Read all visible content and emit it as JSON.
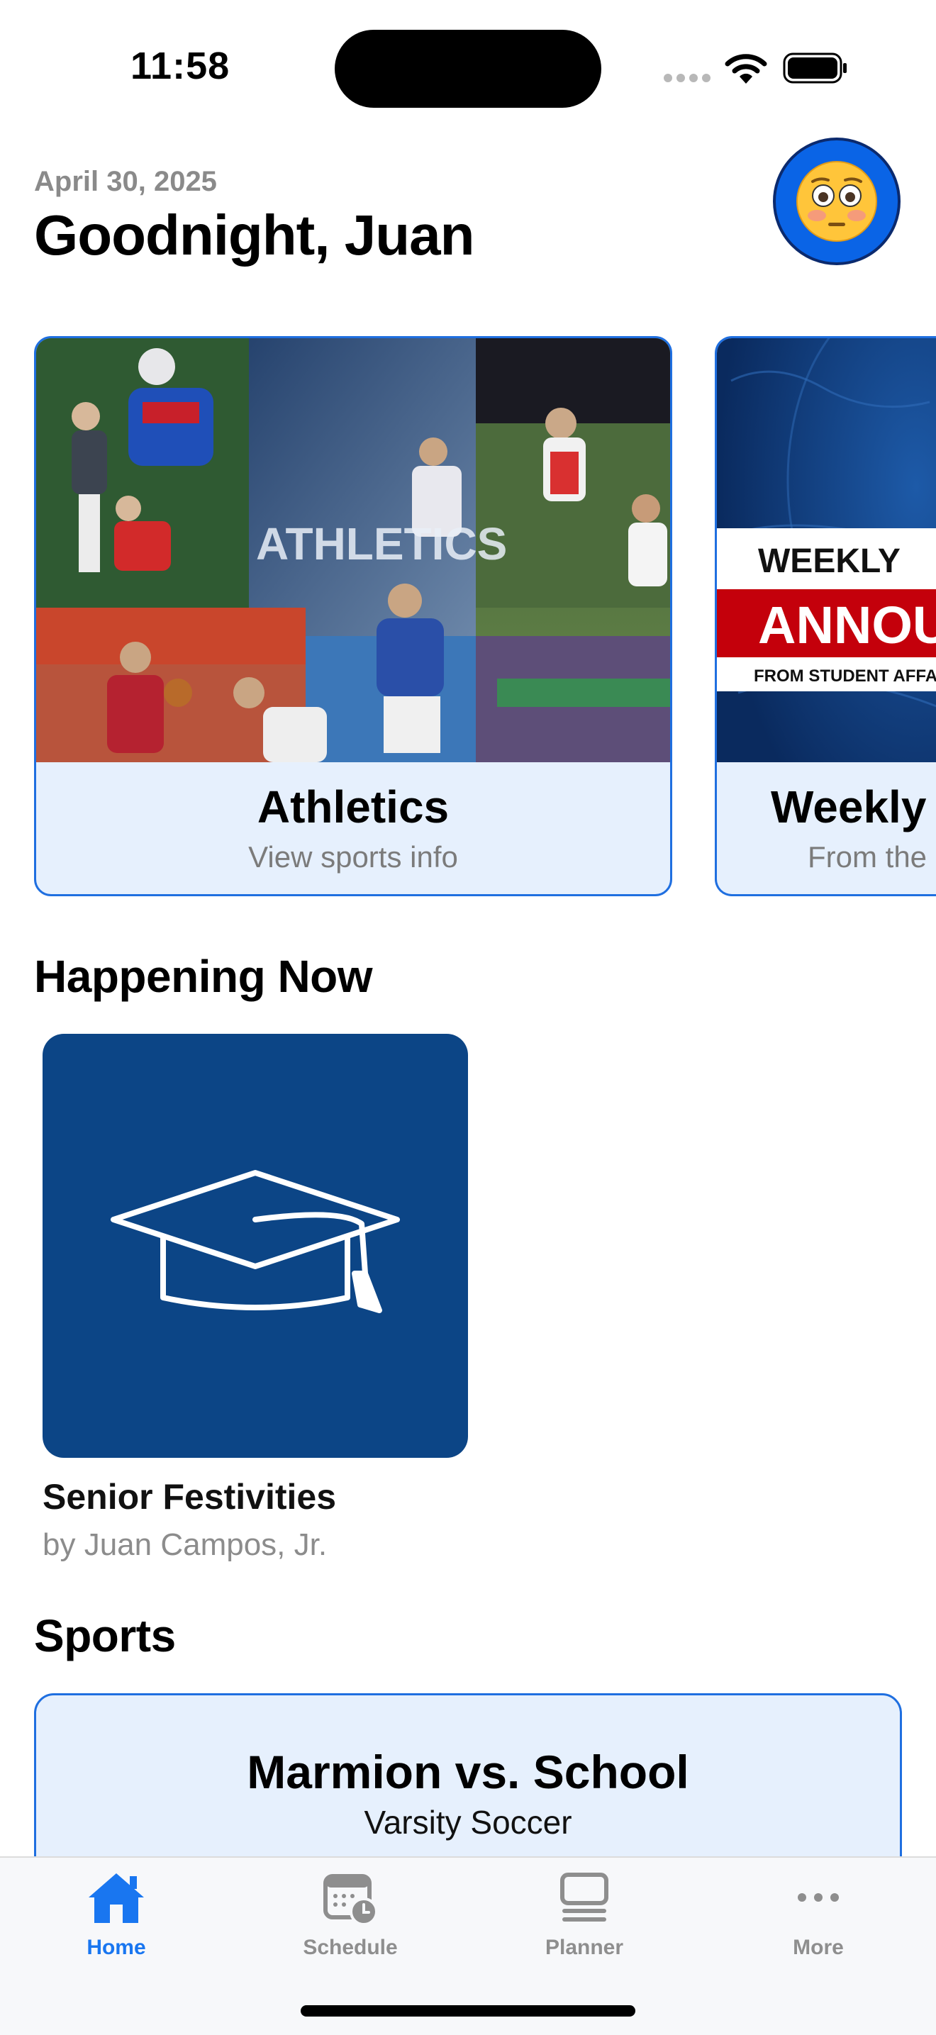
{
  "status_bar": {
    "time": "11:58"
  },
  "header": {
    "date": "April 30, 2025",
    "greeting": "Goodnight, Juan",
    "avatar_emoji": "😳"
  },
  "featured": [
    {
      "title": "Athletics",
      "subtitle": "View sports info",
      "banner_text": "ATHLETICS"
    },
    {
      "title": "Weekly",
      "subtitle": "From the",
      "banner_weekly": "WEEKLY",
      "banner_announce": "ANNOU",
      "banner_from": "FROM STUDENT AFFAI"
    }
  ],
  "happening_now": {
    "heading": "Happening Now",
    "event": {
      "title": "Senior Festivities",
      "author": "by Juan Campos, Jr.",
      "icon": "graduation-cap-icon"
    }
  },
  "sports": {
    "heading": "Sports",
    "game": {
      "title": "Marmion vs. School",
      "subtitle": "Varsity Soccer"
    }
  },
  "tabs": [
    {
      "label": "Home",
      "icon": "house-icon",
      "active": true
    },
    {
      "label": "Schedule",
      "icon": "calendar-clock-icon",
      "active": false
    },
    {
      "label": "Planner",
      "icon": "planner-icon",
      "active": false
    },
    {
      "label": "More",
      "icon": "ellipsis-icon",
      "active": false
    }
  ],
  "colors": {
    "accent": "#1976f0",
    "card_bg": "#e6f0fd",
    "tile_navy": "#0c4586",
    "banner_red": "#c4000b"
  }
}
